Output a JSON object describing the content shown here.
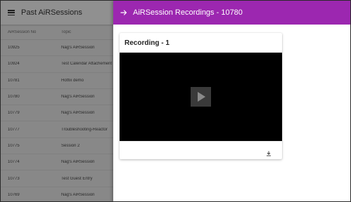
{
  "left_panel": {
    "title": "Past AiRSessions",
    "columns": [
      "AiRSession No",
      "Topic"
    ],
    "rows": [
      {
        "no": "10925",
        "topic": "Nag's AiRSession"
      },
      {
        "no": "10924",
        "topic": "Test Calendar Attachement"
      },
      {
        "no": "10781",
        "topic": "Hotfix demo"
      },
      {
        "no": "10780",
        "topic": "Nag's AiRSession"
      },
      {
        "no": "10779",
        "topic": "Nag's AiRSession"
      },
      {
        "no": "10777",
        "topic": "Troubleshooting-Reactor"
      },
      {
        "no": "10775",
        "topic": "Session 2"
      },
      {
        "no": "10774",
        "topic": "Nag's AiRSession"
      },
      {
        "no": "10773",
        "topic": "Test Guest Entry"
      },
      {
        "no": "10769",
        "topic": "Nag's AiRSession"
      }
    ]
  },
  "right_panel": {
    "title": "AiRSession Recordings - 10780",
    "accent_color": "#9c27b0",
    "recordings": [
      {
        "label": "Recording - 1"
      }
    ]
  },
  "icons": {
    "menu": "menu-icon",
    "back": "arrow-right-icon",
    "play": "play-icon",
    "download": "download-icon"
  }
}
